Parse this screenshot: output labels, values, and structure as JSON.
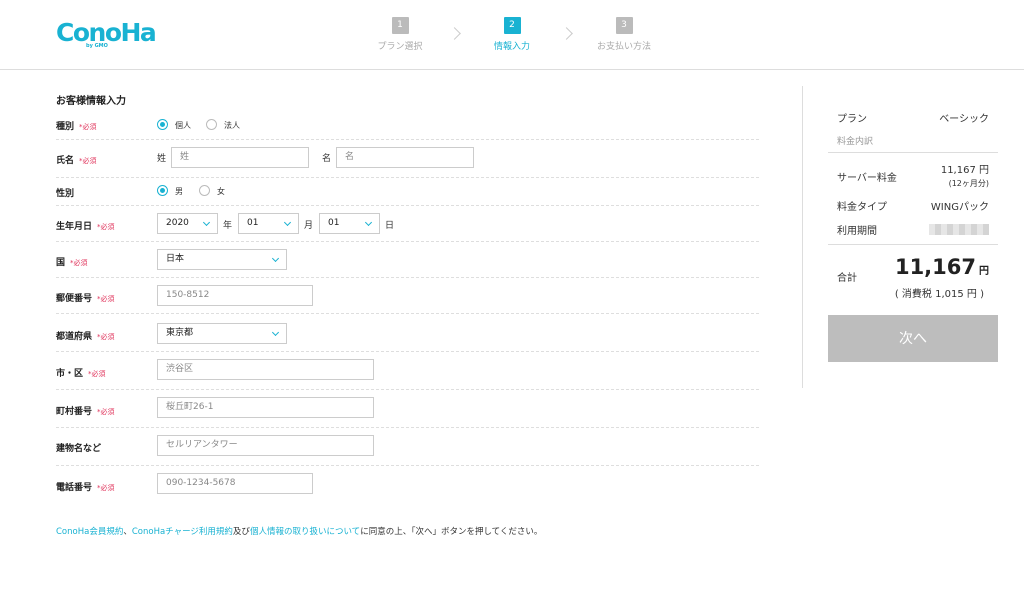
{
  "brand": {
    "logo": "ConoHa",
    "logo_sub": "by GMO"
  },
  "steps": [
    {
      "num": "1",
      "label": "プラン選択"
    },
    {
      "num": "2",
      "label": "情報入力"
    },
    {
      "num": "3",
      "label": "お支払い方法"
    }
  ],
  "form": {
    "title": "お客様情報入力",
    "required_mark": "*必須",
    "type": {
      "label": "種別",
      "options": [
        "個人",
        "法人"
      ],
      "selected": "個人"
    },
    "name": {
      "label": "氏名",
      "last_label": "姓",
      "last_placeholder": "姓",
      "first_label": "名",
      "first_placeholder": "名"
    },
    "gender": {
      "label": "性別",
      "options": [
        "男",
        "女"
      ],
      "selected": "男"
    },
    "birth": {
      "label": "生年月日",
      "year": "2020",
      "year_unit": "年",
      "month": "01",
      "month_unit": "月",
      "day": "01",
      "day_unit": "日"
    },
    "country": {
      "label": "国",
      "value": "日本"
    },
    "postal": {
      "label": "郵便番号",
      "placeholder": "150-8512"
    },
    "prefecture": {
      "label": "都道府県",
      "value": "東京都"
    },
    "city": {
      "label": "市・区",
      "placeholder": "渋谷区"
    },
    "town": {
      "label": "町村番号",
      "placeholder": "桜丘町26-1"
    },
    "building": {
      "label": "建物名など",
      "placeholder": "セルリアンタワー"
    },
    "phone": {
      "label": "電話番号",
      "placeholder": "090-1234-5678"
    }
  },
  "terms": {
    "link1": "ConoHa会員規約",
    "sep1": "、",
    "link2": "ConoHaチャージ利用規約",
    "sep2": "及び",
    "link3": "個人情報の取り扱いについて",
    "text": "に同意の上、「次へ」ボタンを押してください。"
  },
  "summary": {
    "plan_label": "プラン",
    "plan_value": "ベーシック",
    "breakdown_label": "料金内訳",
    "server_fee_label": "サーバー料金",
    "server_fee_value": "11,167 円",
    "server_fee_note": "(12ヶ月分)",
    "fee_type_label": "料金タイプ",
    "fee_type_value": "WINGパック",
    "period_label": "利用期間",
    "total_label": "合計",
    "total_value": "11,167",
    "total_unit": "円",
    "tax_note": "( 消費税 1,015 円 )",
    "next_button": "次へ"
  },
  "colors": {
    "accent": "#19b2d2",
    "required": "#e0325a",
    "button_disabled": "#bdbdbd"
  }
}
